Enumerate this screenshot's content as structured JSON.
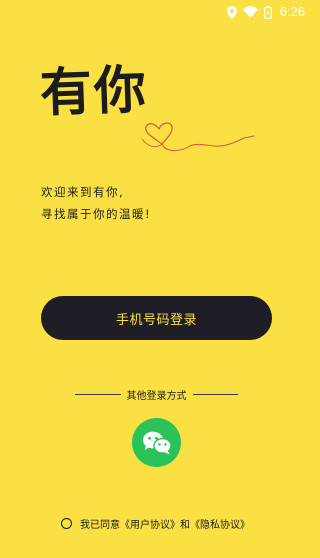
{
  "status_bar": {
    "time": "6:26",
    "icons": [
      "location-icon",
      "wifi-icon",
      "battery-icon"
    ]
  },
  "brand": {
    "title": "有你"
  },
  "welcome": {
    "line1": "欢迎来到有你,",
    "line2": "寻找属于你的温暖!"
  },
  "login": {
    "phone_label": "手机号码登录"
  },
  "other_login": {
    "label": "其他登录方式",
    "icon": "wechat-icon"
  },
  "agreement": {
    "prefix": "我已同意",
    "user_agreement": "《用户协议》",
    "conjunction": "和",
    "privacy_agreement": "《隐私协议》"
  },
  "colors": {
    "background": "#fbe043",
    "button": "#1f1e26",
    "button_text": "#fbe043",
    "wechat": "#2bc25a",
    "heart": "#e0533a"
  }
}
